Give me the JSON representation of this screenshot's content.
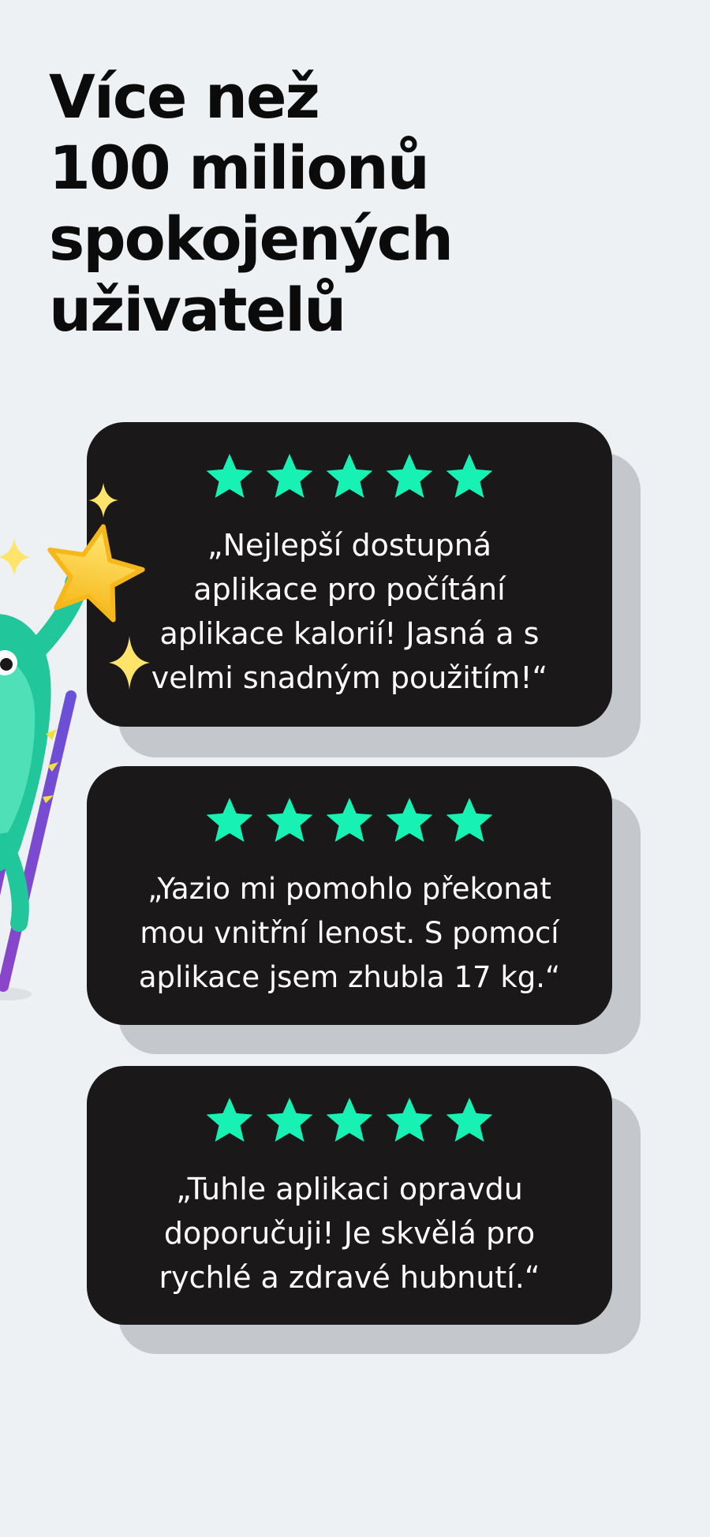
{
  "headline": {
    "lines": [
      "Více než",
      "100 milionů",
      "spokojených",
      "uživatelů"
    ]
  },
  "reviews": [
    {
      "rating": 5,
      "text": "„Nejlepší dostupná\naplikace pro počítání\naplikace kalorií! Jasná a s\nvelmi snadným použitím!“"
    },
    {
      "rating": 5,
      "text": "„Yazio mi pomohlo překonat\nmou vnitřní lenost. S pomocí\naplikace jsem zhubla 17 kg.“"
    },
    {
      "rating": 5,
      "text": "„Tuhle aplikaci opravdu\ndoporučuji! Je skvělá pro\nrychlé a zdravé hubnutí.“"
    }
  ],
  "colors": {
    "background": "#eef1f4",
    "card": "#1a1818",
    "star": "#17f2b4",
    "headline": "#0b0b0b"
  },
  "icons": {
    "rating": "star-icon",
    "mascot": "green-monster-mascot-with-star"
  }
}
